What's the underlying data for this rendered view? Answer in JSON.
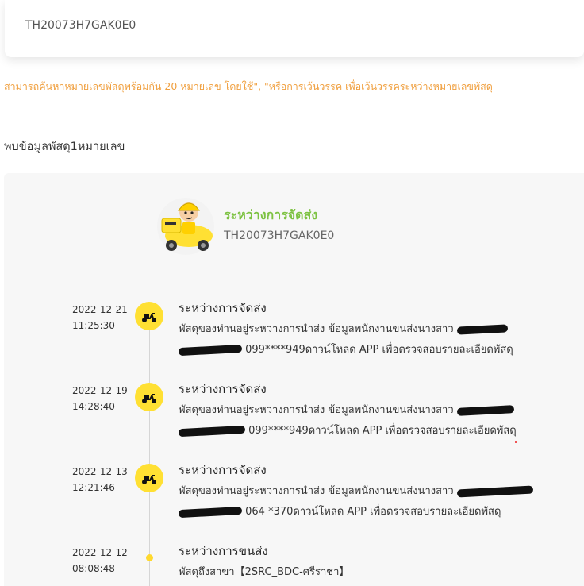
{
  "search": {
    "value": "TH20073H7GAK0E0"
  },
  "hint": "สามารถค้นหาหมายเลขพัสดุพร้อมกัน 20 หมายเลข โดยใช้\", \"หรือการเว้นวรรค เพื่อเว้นวรรคระหว่างหมายเลขพัสดุ",
  "found_text": "พบข้อมูลพัสดุ1หมายเลข",
  "status": {
    "title": "ระหว่างการจัดส่ง",
    "tracking": "TH20073H7GAK0E0"
  },
  "colors": {
    "accent_green": "#7dc242",
    "badge_yellow": "#ffe033",
    "hint_orange": "#f0a040"
  },
  "events": [
    {
      "date": "2022-12-21",
      "time": "11:25:30",
      "icon": "scooter-icon",
      "title": "ระหว่างการจัดส่ง",
      "line1": "พัสดุของท่านอยู่ระหว่างการนำส่ง ข้อมูลพนักงานขนส่งนางสาว",
      "line2": "099****949ดาวน์โหลด APP เพื่อตรวจสอบรายละเอียดพัสดุ"
    },
    {
      "date": "2022-12-19",
      "time": "14:28:40",
      "icon": "scooter-icon",
      "title": "ระหว่างการจัดส่ง",
      "line1": "พัสดุของท่านอยู่ระหว่างการนำส่ง ข้อมูลพนักงานขนส่งนางสาว",
      "line2": "099****949ดาวน์โหลด APP เพื่อตรวจสอบรายละเอียดพัสดุ"
    },
    {
      "date": "2022-12-13",
      "time": "12:21:46",
      "icon": "scooter-icon",
      "title": "ระหว่างการจัดส่ง",
      "line1": "พัสดุของท่านอยู่ระหว่างการนำส่ง ข้อมูลพนักงานขนส่งนางสาว",
      "line2": "064    *370ดาวน์โหลด APP เพื่อตรวจสอบรายละเอียดพัสดุ"
    },
    {
      "date": "2022-12-12",
      "time": "08:08:48",
      "icon": "dot-icon",
      "title": "ระหว่างการขนส่ง",
      "line1": "พัสดุถึงสาขา【2SRC_BDC-ศรีราชา】",
      "line2": ""
    }
  ]
}
